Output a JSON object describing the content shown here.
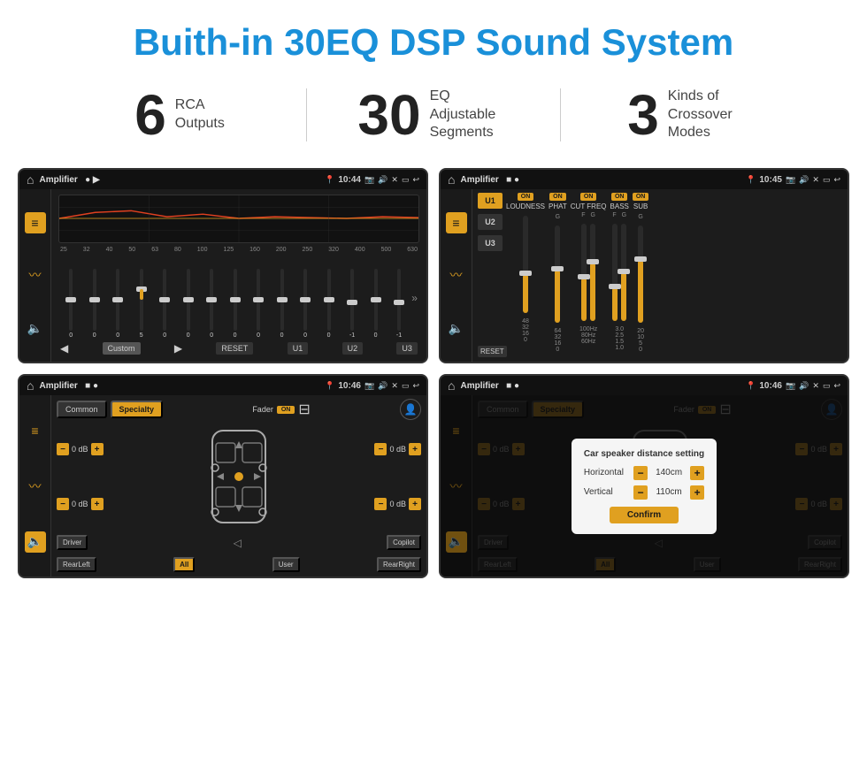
{
  "header": {
    "title": "Buith-in 30EQ DSP Sound System"
  },
  "stats": [
    {
      "number": "6",
      "text": "RCA\nOutputs"
    },
    {
      "number": "30",
      "text": "EQ Adjustable\nSegments"
    },
    {
      "number": "3",
      "text": "Kinds of\nCrossover Modes"
    }
  ],
  "screens": [
    {
      "id": "screen1",
      "statusBar": {
        "title": "Amplifier",
        "time": "10:44"
      },
      "type": "eq"
    },
    {
      "id": "screen2",
      "statusBar": {
        "title": "Amplifier",
        "time": "10:45"
      },
      "type": "crossover"
    },
    {
      "id": "screen3",
      "statusBar": {
        "title": "Amplifier",
        "time": "10:46"
      },
      "type": "fader"
    },
    {
      "id": "screen4",
      "statusBar": {
        "title": "Amplifier",
        "time": "10:46"
      },
      "type": "fader-dialog",
      "dialog": {
        "title": "Car speaker distance setting",
        "horizontal": {
          "label": "Horizontal",
          "value": "140cm"
        },
        "vertical": {
          "label": "Vertical",
          "value": "110cm"
        },
        "confirm": "Confirm"
      }
    }
  ],
  "eq": {
    "freqs": [
      "25",
      "32",
      "40",
      "50",
      "63",
      "80",
      "100",
      "125",
      "160",
      "200",
      "250",
      "320",
      "400",
      "500",
      "630"
    ],
    "values": [
      "0",
      "0",
      "0",
      "5",
      "0",
      "0",
      "0",
      "0",
      "0",
      "0",
      "0",
      "0",
      "-1",
      "0",
      "-1"
    ],
    "thumbPositions": [
      50,
      50,
      50,
      35,
      50,
      50,
      50,
      50,
      50,
      50,
      50,
      50,
      58,
      50,
      58
    ],
    "buttons": [
      "Custom",
      "RESET",
      "U1",
      "U2",
      "U3"
    ]
  },
  "crossover": {
    "presets": [
      "U1",
      "U2",
      "U3"
    ],
    "channels": [
      {
        "label": "LOUDNESS",
        "on": true
      },
      {
        "label": "PHAT",
        "on": true
      },
      {
        "label": "CUT FREQ",
        "on": true
      },
      {
        "label": "BASS",
        "on": true
      },
      {
        "label": "SUB",
        "on": true
      }
    ],
    "resetBtn": "RESET"
  },
  "fader": {
    "tabs": [
      "Common",
      "Specialty"
    ],
    "faderLabel": "Fader",
    "onLabel": "ON",
    "dbValues": [
      "0 dB",
      "0 dB",
      "0 dB",
      "0 dB"
    ],
    "bottomBtns": [
      "Driver",
      "",
      "Copilot",
      "RearLeft",
      "All",
      "User",
      "RearRight"
    ]
  },
  "dialog": {
    "title": "Car speaker distance setting",
    "horizontal": "140cm",
    "vertical": "110cm",
    "confirm": "Confirm"
  }
}
